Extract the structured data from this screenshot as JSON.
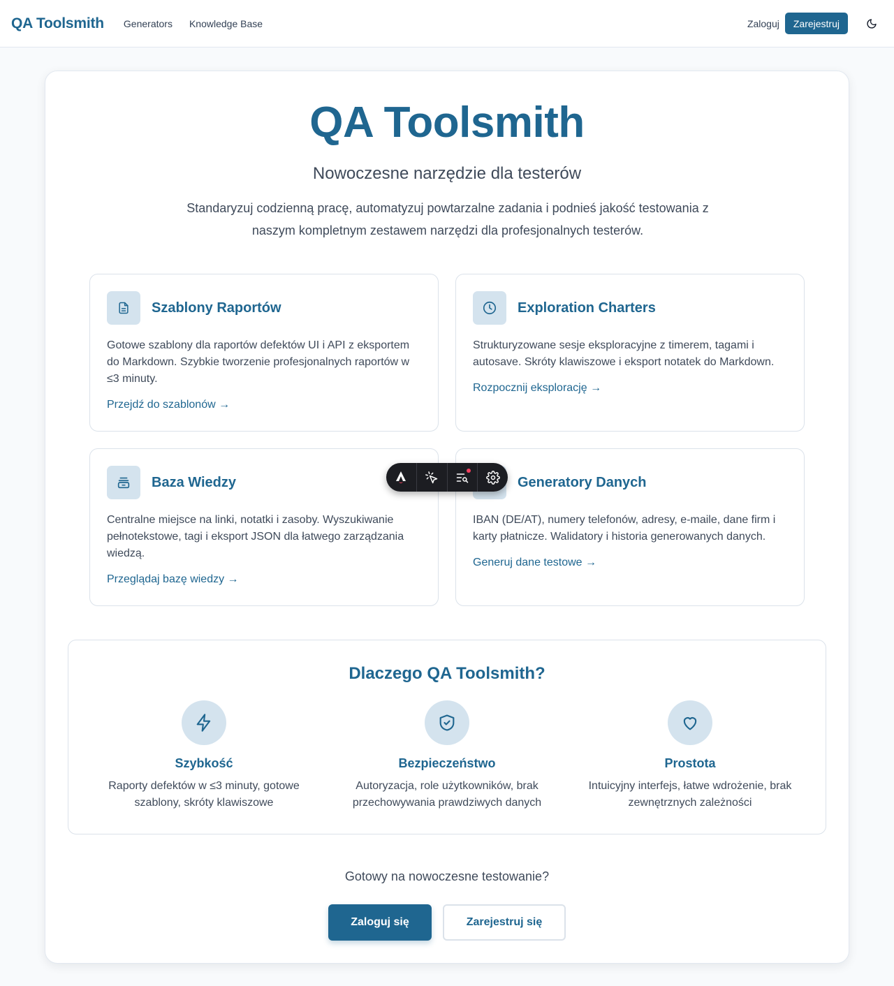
{
  "header": {
    "brand": "QA Toolsmith",
    "nav": [
      "Generators",
      "Knowledge Base"
    ],
    "login": "Zaloguj",
    "register": "Zarejestruj"
  },
  "hero": {
    "title": "QA Toolsmith",
    "subtitle": "Nowoczesne narzędzie dla testerów",
    "description": "Standaryzuj codzienną pracę, automatyzuj powtarzalne zadania i podnieś jakość testowania z naszym kompletnym zestawem narzędzi dla profesjonalnych testerów."
  },
  "features": [
    {
      "icon": "document-icon",
      "title": "Szablony Raportów",
      "description": "Gotowe szablony dla raportów defektów UI i API z eksportem do Markdown. Szybkie tworzenie profesjonalnych raportów w ≤3 minuty.",
      "link": "Przejdź do szablonów →"
    },
    {
      "icon": "clock-icon",
      "title": "Exploration Charters",
      "description": "Strukturyzowane sesje eksploracyjne z timerem, tagami i autosave. Skróty klawiszowe i eksport notatek do Markdown.",
      "link": "Rozpocznij eksplorację →"
    },
    {
      "icon": "archive-icon",
      "title": "Baza Wiedzy",
      "description": "Centralne miejsce na linki, notatki i zasoby. Wyszukiwanie pełnotekstowe, tagi i eksport JSON dla łatwego zarządzania wiedzą.",
      "link": "Przeglądaj bazę wiedzy →"
    },
    {
      "icon": "database-icon",
      "title": "Generatory Danych",
      "description": "IBAN (DE/AT), numery telefonów, adresy, e-maile, dane firm i karty płatnicze. Walidatory i historia generowanych danych.",
      "link": "Generuj dane testowe →"
    }
  ],
  "why": {
    "title": "Dlaczego QA Toolsmith?",
    "items": [
      {
        "icon": "lightning-icon",
        "title": "Szybkość",
        "description": "Raporty defektów w ≤3 minuty, gotowe szablony, skróty klawiszowe"
      },
      {
        "icon": "shield-check-icon",
        "title": "Bezpieczeństwo",
        "description": "Autoryzacja, role użytkowników, brak przechowywania prawdziwych danych"
      },
      {
        "icon": "heart-icon",
        "title": "Prostota",
        "description": "Intuicyjny interfejs, łatwe wdrożenie, brak zewnętrznych zależności"
      }
    ]
  },
  "cta": {
    "text": "Gotowy na nowoczesne testowanie?",
    "primary": "Zaloguj się",
    "secondary": "Zarejestruj się"
  },
  "colors": {
    "accent": "#1f6690",
    "icon_bg": "#d4e3ee",
    "toolbar_bg": "#1c1d22",
    "notification": "#f43f5e"
  }
}
